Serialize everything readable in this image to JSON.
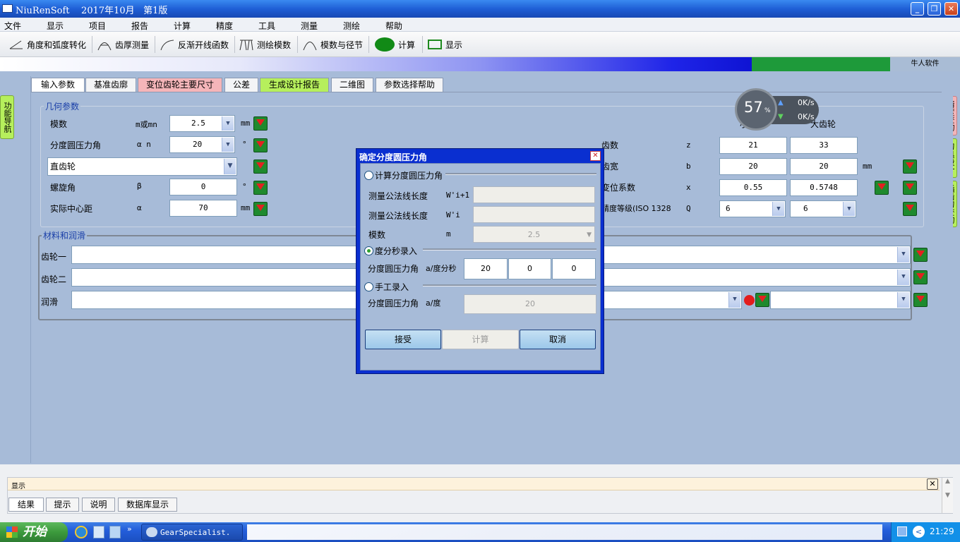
{
  "window": {
    "title": "NiuRenSoft    2017年10月   第1版",
    "min_btn": "_",
    "max_btn": "❐",
    "close_btn": "✕"
  },
  "menu": [
    "文件",
    "显示",
    "项目",
    "报告",
    "计算",
    "精度",
    "工具",
    "测量",
    "测绘",
    "帮助"
  ],
  "toolbar": {
    "angle_radian": "角度和弧度转化",
    "tooth_thickness": "齿厚测量",
    "inv_function": "反渐开线函数",
    "measure_module": "测绘模数",
    "module_pitch": "模数与径节",
    "calculate": "计算",
    "display": "显示"
  },
  "brand_band": "牛人软件",
  "left_nav": "功能导航",
  "right_nav": {
    "accuracy": "精度查询",
    "tool_design": "刀具设计",
    "hob_query": "插齿刀查询"
  },
  "tabs": [
    "输入参数",
    "基准齿廓",
    "变位齿轮主要尺寸",
    "公差",
    "生成设计报告",
    "二维图",
    "参数选择帮助"
  ],
  "geometry": {
    "group_title": "几何参数",
    "module_label": "模数",
    "module_sym": "m或mn",
    "module_val": "2.5",
    "module_unit": "mm",
    "pressure_label": "分度圆压力角",
    "pressure_sym": "α n",
    "pressure_val": "20",
    "pressure_unit": "°",
    "gear_type": "直齿轮",
    "helix_label": "螺旋角",
    "helix_sym": "β",
    "helix_val": "0",
    "helix_unit": "°",
    "center_label": "实际中心距",
    "center_sym": "α",
    "center_val": "70",
    "center_unit": "mm",
    "small_gear": "小齿轮",
    "large_gear": "大齿轮",
    "teeth_label": "齿数",
    "teeth_sym": "z",
    "teeth_small": "21",
    "teeth_large": "33",
    "width_label": "齿宽",
    "width_sym": "b",
    "width_small": "20",
    "width_large": "20",
    "width_unit": "mm",
    "shift_label": "变位系数",
    "shift_sym": "x",
    "shift_small": "0.55",
    "shift_large": "0.5748",
    "grade_label": "精度等级(ISO 1328",
    "grade_sym": "Q",
    "grade_small": "6",
    "grade_large": "6"
  },
  "material": {
    "group_title": "材料和润滑",
    "gear1": "齿轮一",
    "gear2": "齿轮二",
    "lube": "润滑"
  },
  "net_widget": {
    "percent": "57",
    "pct_sign": "%",
    "up": "0K/s",
    "down": "0K/s"
  },
  "dialog": {
    "title": "确定分度圆压力角",
    "opt_calc": "计算分度圆压力角",
    "wk1_label": "测量公法线长度",
    "wk1_sym": "W'i+1",
    "wk_label": "测量公法线长度",
    "wk_sym": "W'i",
    "module_label": "模数",
    "module_sym": "m",
    "module_val": "2.5",
    "opt_dms": "度分秒录入",
    "dms_label": "分度圆压力角",
    "dms_sym": "a/度分秒",
    "deg": "20",
    "min": "0",
    "sec": "0",
    "opt_manual": "手工录入",
    "manual_label": "分度圆压力角",
    "manual_sym": "a/度",
    "manual_val": "20",
    "accept": "接受",
    "calc": "计算",
    "cancel": "取消"
  },
  "bottom": {
    "title": "显示",
    "tabs": [
      "结果",
      "提示",
      "说明",
      "数据库显示"
    ]
  },
  "taskbar": {
    "start": "开始",
    "task": "GearSpecialist.",
    "clock": "21:29"
  }
}
